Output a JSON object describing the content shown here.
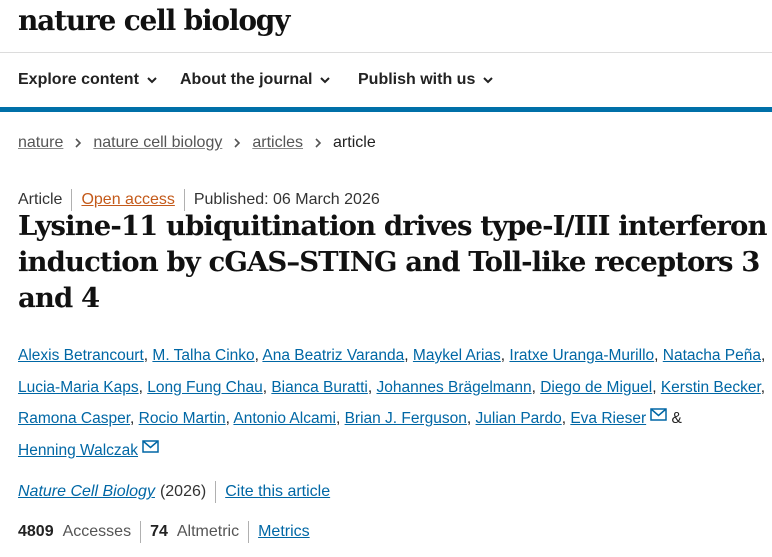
{
  "site": {
    "logo": "nature cell biology"
  },
  "nav": {
    "items": [
      "Explore content",
      "About the journal",
      "Publish with us"
    ]
  },
  "breadcrumb": {
    "items": [
      "nature",
      "nature cell biology",
      "articles"
    ],
    "current": "article"
  },
  "meta": {
    "type": "Article",
    "access": "Open access",
    "published": "Published: 06 March 2026"
  },
  "title": "Lysine-11 ubiquitination drives type-I/III interferon induction by cGAS–STING and Toll-like receptors 3 and 4",
  "authors": [
    "Alexis Betrancourt",
    "M. Talha Cinko",
    "Ana Beatriz Varanda",
    "Maykel Arias",
    "Iratxe Uranga-Murillo",
    "Natacha Peña",
    "Lucia-Maria Kaps",
    "Long Fung Chau",
    "Bianca Buratti",
    "Johannes Brägelmann",
    "Diego de Miguel",
    "Kerstin Becker",
    "Ramona Casper",
    "Rocio Martin",
    "Antonio Alcami",
    "Brian J. Ferguson",
    "Julian Pardo",
    "Eva Rieser",
    "Henning Walczak"
  ],
  "authors_conjunction": "&",
  "citation": {
    "journal": "Nature Cell Biology",
    "year": "(2026)",
    "cite_label": "Cite this article"
  },
  "metrics": {
    "accesses_count": "4809",
    "accesses_label": "Accesses",
    "altmetric_count": "74",
    "altmetric_label": "Altmetric",
    "metrics_link": "Metrics"
  },
  "colors": {
    "brand_blue": "#0070a8",
    "link": "#0067a5",
    "open_access": "#c45a1a"
  },
  "icons": {
    "nav_chevron": "chevron-down-icon",
    "breadcrumb_sep": "chevron-right-icon",
    "email": "envelope-icon"
  }
}
